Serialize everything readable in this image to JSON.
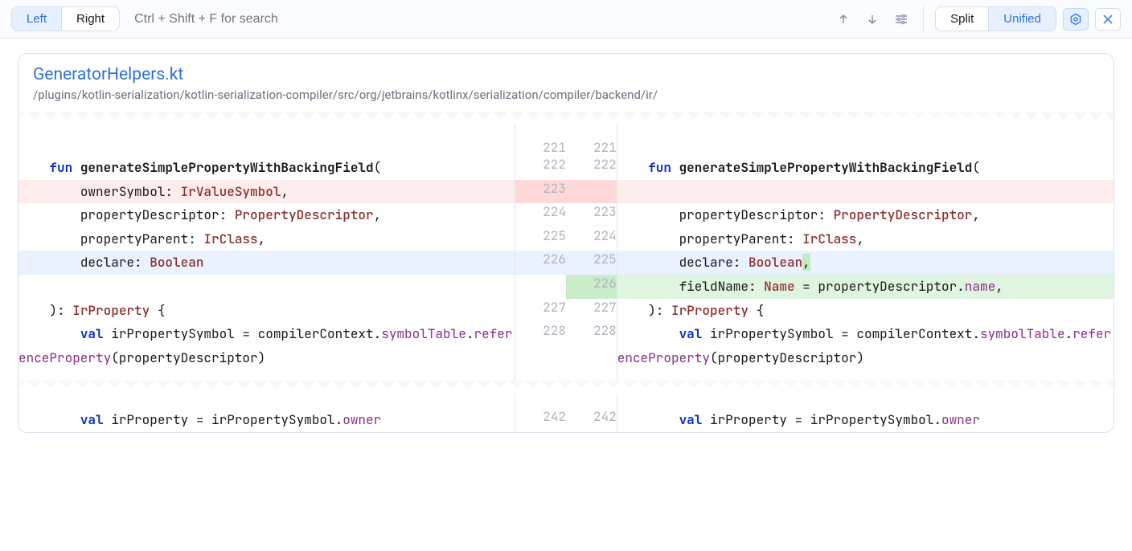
{
  "toolbar": {
    "left_label": "Left",
    "right_label": "Right",
    "search_placeholder": "Ctrl + Shift + F for search",
    "split_label": "Split",
    "unified_label": "Unified"
  },
  "file": {
    "title": "GeneratorHelpers.kt",
    "path": "/plugins/kotlin-serialization/kotlin-serialization-compiler/src/org/jetbrains/kotlinx/serialization/compiler/backend/ir/"
  },
  "ln": {
    "l221": "221",
    "r221": "221",
    "l222": "222",
    "r222": "222",
    "l223": "223",
    "l224": "224",
    "r223": "223",
    "l225": "225",
    "r224": "224",
    "l226": "226",
    "r225": "225",
    "r226": "226",
    "l227": "227",
    "r227": "227",
    "l228": "228",
    "r228": "228",
    "l242": "242",
    "r242": "242"
  },
  "code": {
    "l1": "",
    "r1": "",
    "l2a": "    fun",
    "l2b": "generateSimplePropertyWithBackingField",
    "l2c": "(",
    "r2a": "    fun",
    "r2b": "generateSimplePropertyWithBackingField",
    "r2c": "(",
    "l3a": "        ownerSymbol: ",
    "l3b": "IrValueSymbol",
    "l3c": ",",
    "l4a": "        propertyDescriptor: ",
    "l4b": "PropertyDescriptor",
    "l4c": ",",
    "r4a": "        propertyDescriptor: ",
    "r4b": "PropertyDescriptor",
    "r4c": ",",
    "l5a": "        propertyParent: ",
    "l5b": "IrClass",
    "l5c": ",",
    "r5a": "        propertyParent: ",
    "r5b": "IrClass",
    "r5c": ",",
    "l6a": "        declare: ",
    "l6b": "Boolean",
    "r6a": "        declare: ",
    "r6b": "Boolean",
    "r6c": ",",
    "r7a": "        fieldName: ",
    "r7b": "Name",
    "r7c": " = propertyDescriptor.",
    "r7d": "name",
    "r7e": ",",
    "l8a": "    ): ",
    "l8b": "IrProperty",
    "l8c": " {",
    "r8a": "    ): ",
    "r8b": "IrProperty",
    "r8c": " {",
    "l9a": "        val",
    "l9b": " irPropertySymbol = compilerContext.",
    "l9c": "symbolTable",
    "l9d": ".",
    "l9e": "referenceProperty",
    "l9f": "(propertyDescriptor)",
    "r9a": "        val",
    "r9b": " irPropertySymbol = compilerContext.",
    "r9c": "symbolTable",
    "r9d": ".",
    "r9e": "referenceProperty",
    "r9f": "(propertyDescriptor)",
    "l10a": "        val",
    "l10b": " irProperty = irPropertySymbol.",
    "l10c": "owner",
    "r10a": "        val",
    "r10b": " irProperty = irPropertySymbol.",
    "r10c": "owner"
  }
}
